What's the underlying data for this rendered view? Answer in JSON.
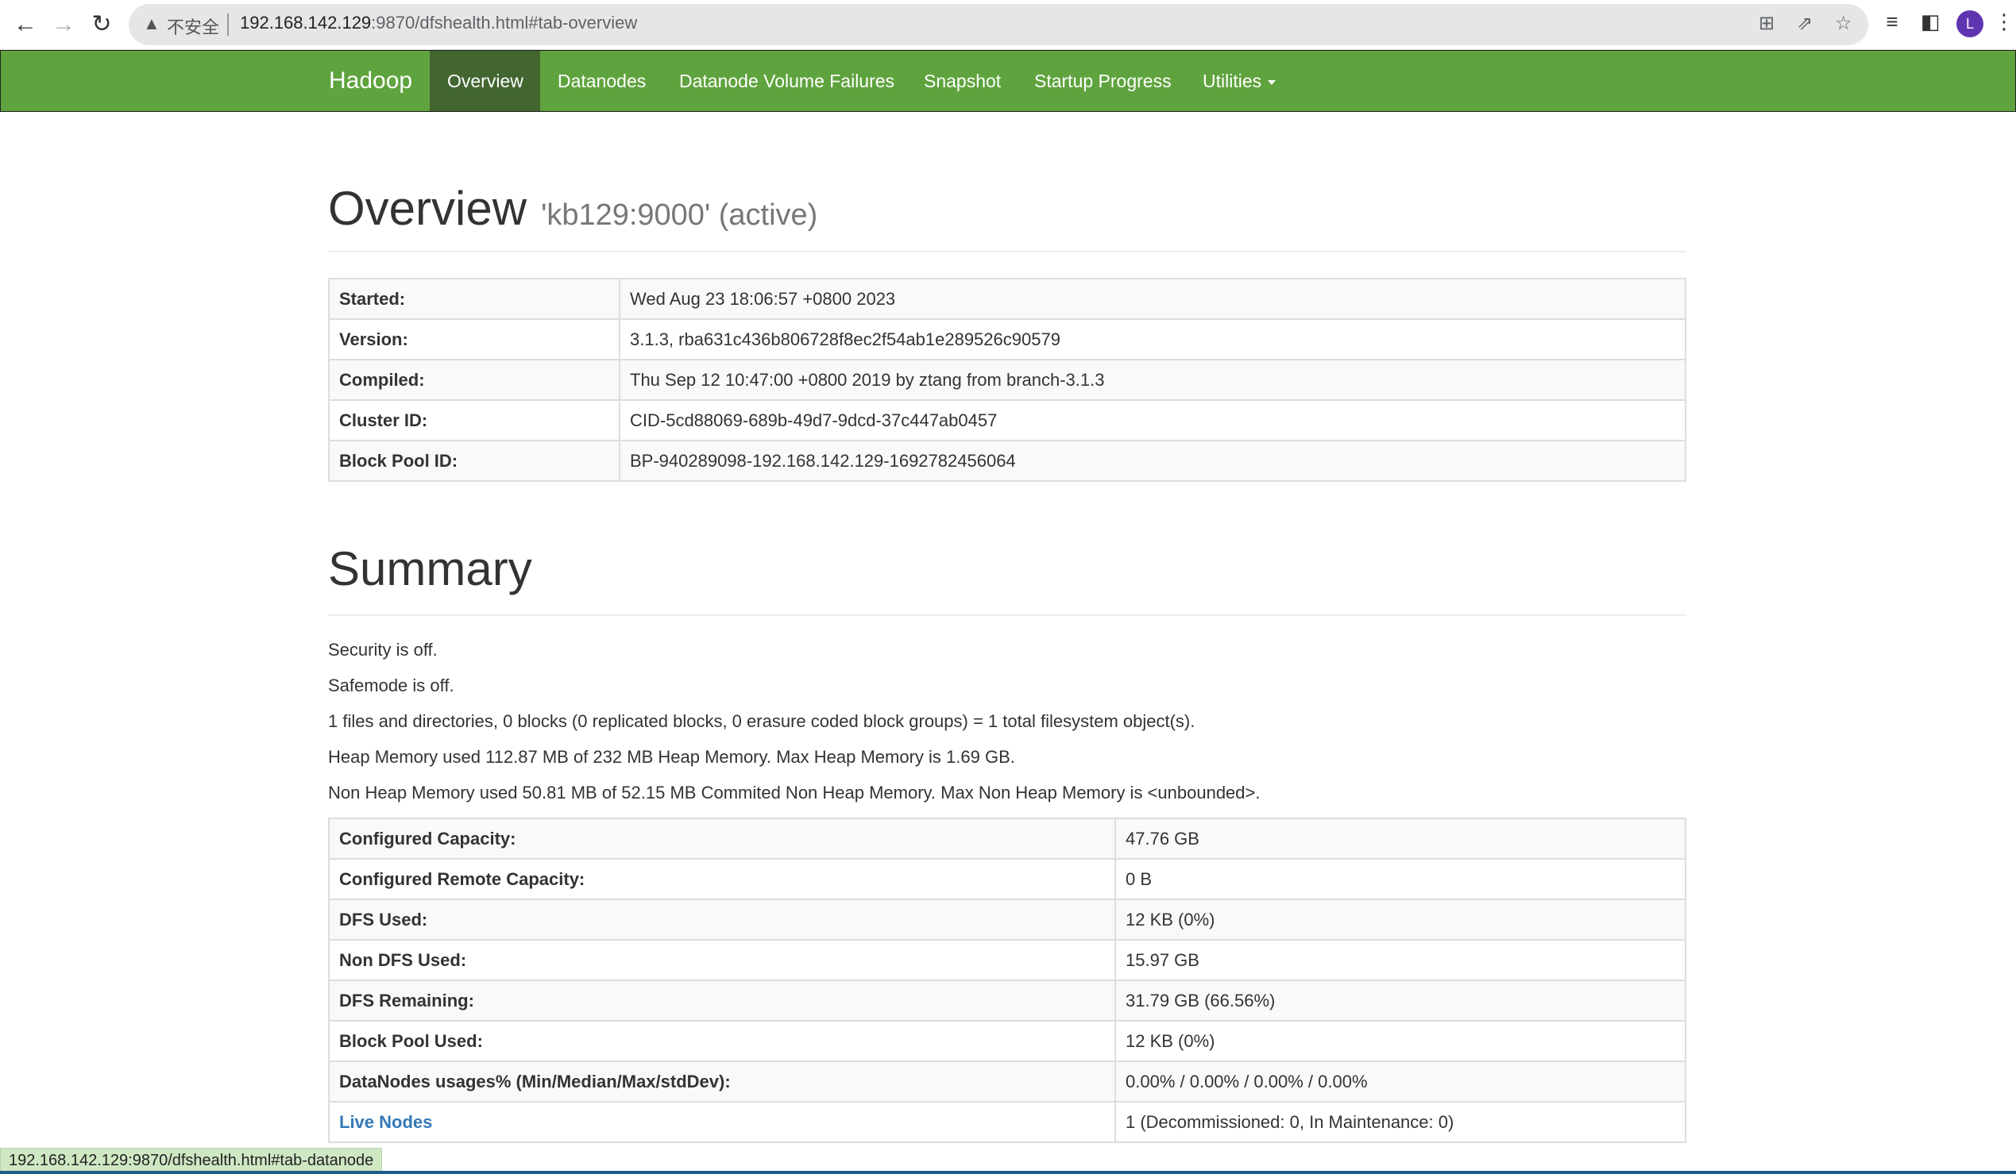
{
  "browser": {
    "back_icon": "←",
    "forward_icon": "→",
    "reload_icon": "↻",
    "security_label": "不安全",
    "url_host": "192.168.142.129",
    "url_rest": ":9870/dfshealth.html#tab-overview",
    "avatar_letter": "L",
    "status_url": "192.168.142.129:9870/dfshealth.html#tab-datanode"
  },
  "navbar": {
    "brand": "Hadoop",
    "items": [
      {
        "label": "Overview",
        "active": true
      },
      {
        "label": "Datanodes"
      },
      {
        "label": "Datanode Volume Failures"
      },
      {
        "label": "Snapshot"
      },
      {
        "label": "Startup Progress"
      },
      {
        "label": "Utilities"
      }
    ]
  },
  "overview": {
    "title": "Overview",
    "subtitle": "'kb129:9000' (active)",
    "rows": [
      {
        "key": "Started:",
        "value": "Wed Aug 23 18:06:57 +0800 2023"
      },
      {
        "key": "Version:",
        "value": "3.1.3, rba631c436b806728f8ec2f54ab1e289526c90579"
      },
      {
        "key": "Compiled:",
        "value": "Thu Sep 12 10:47:00 +0800 2019 by ztang from branch-3.1.3"
      },
      {
        "key": "Cluster ID:",
        "value": "CID-5cd88069-689b-49d7-9dcd-37c447ab0457"
      },
      {
        "key": "Block Pool ID:",
        "value": "BP-940289098-192.168.142.129-1692782456064"
      }
    ]
  },
  "summary": {
    "title": "Summary",
    "lines": [
      "Security is off.",
      "Safemode is off.",
      "1 files and directories, 0 blocks (0 replicated blocks, 0 erasure coded block groups) = 1 total filesystem object(s).",
      "Heap Memory used 112.87 MB of 232 MB Heap Memory. Max Heap Memory is 1.69 GB.",
      "Non Heap Memory used 50.81 MB of 52.15 MB Commited Non Heap Memory. Max Non Heap Memory is <unbounded>."
    ],
    "rows": [
      {
        "key": "Configured Capacity:",
        "value": "47.76 GB"
      },
      {
        "key": "Configured Remote Capacity:",
        "value": "0 B"
      },
      {
        "key": "DFS Used:",
        "value": "12 KB (0%)"
      },
      {
        "key": "Non DFS Used:",
        "value": "15.97 GB"
      },
      {
        "key": "DFS Remaining:",
        "value": "31.79 GB (66.56%)"
      },
      {
        "key": "Block Pool Used:",
        "value": "12 KB (0%)"
      },
      {
        "key": "DataNodes usages% (Min/Median/Max/stdDev):",
        "value": "0.00% / 0.00% / 0.00% / 0.00%"
      },
      {
        "key": "Live Nodes",
        "value": "1 (Decommissioned: 0, In Maintenance: 0)",
        "link": true
      }
    ]
  }
}
